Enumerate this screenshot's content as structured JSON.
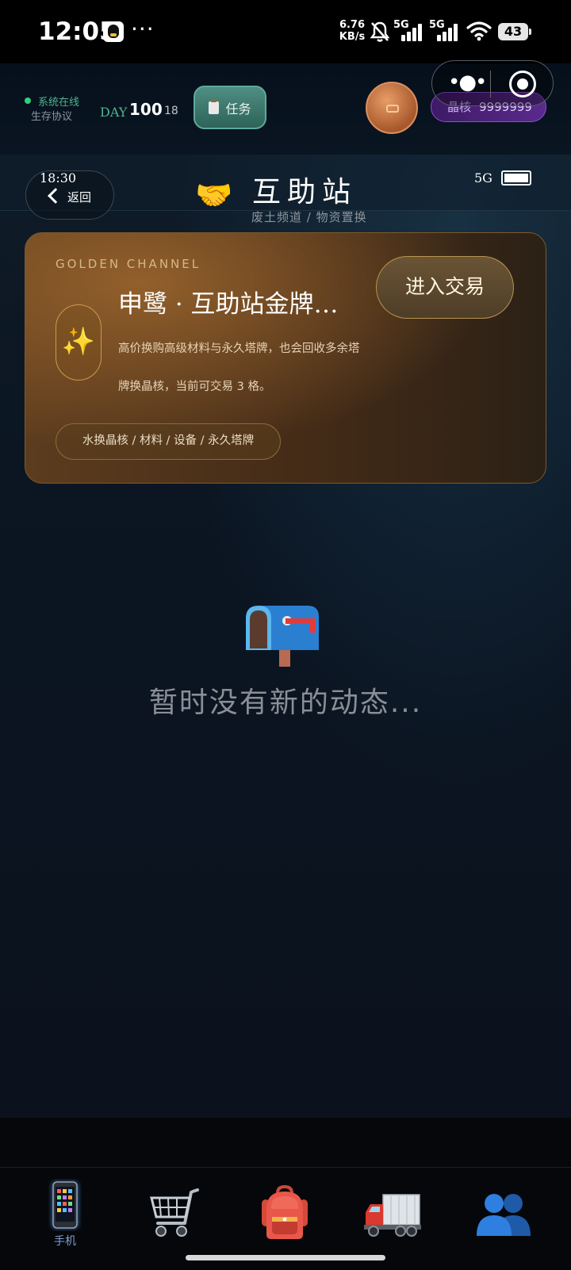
{
  "status_bar": {
    "time": "12:05",
    "more": "···",
    "speed_value": "6.76",
    "speed_unit": "KB/s",
    "network_1": "5G",
    "network_2": "5G",
    "battery": "43"
  },
  "hud": {
    "online_status": "系统在线",
    "protocol": "生存协议",
    "day_label": "DAY",
    "day_value": "100",
    "day_hour": "18",
    "task_label": "任务",
    "crystal_label": "晶核",
    "crystal_value": "9999999"
  },
  "phone": {
    "clock": "18:30",
    "network": "5G",
    "back_label": "返回",
    "title": "互助站",
    "subtitle": "废土频道 / 物资置换"
  },
  "golden_card": {
    "kicker": "GOLDEN CHANNEL",
    "title": "申鹭 · 互助站金牌…",
    "description": "高价换购高级材料与永久塔牌，也会回收多余塔牌换晶核，当前可交易 3 格。",
    "enter_label": "进入交易",
    "tag": "水换晶核 / 材料 / 设备 / 永久塔牌"
  },
  "empty_state": {
    "text": "暂时没有新的动态..."
  },
  "bottom_nav": {
    "items": [
      {
        "icon": "phone-icon",
        "label": "手机",
        "active": true
      },
      {
        "icon": "shopping-cart-icon",
        "label": ""
      },
      {
        "icon": "backpack-icon",
        "label": ""
      },
      {
        "icon": "truck-icon",
        "label": ""
      },
      {
        "icon": "people-icon",
        "label": ""
      }
    ]
  },
  "colors": {
    "accent_gold": "#c79b50",
    "online_green": "#2fcf7d",
    "crystal_purple": "#5a2a8e",
    "task_teal": "#4f8e83"
  }
}
